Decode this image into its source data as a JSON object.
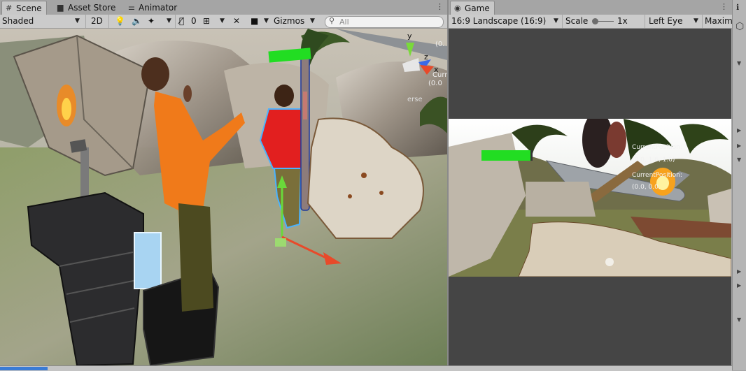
{
  "scene_tabs": [
    {
      "label": "Scene",
      "icon": "grid-icon"
    },
    {
      "label": "Asset Store",
      "icon": "store-icon"
    },
    {
      "label": "Animator",
      "icon": "animator-icon"
    }
  ],
  "scene_toolbar": {
    "draw_mode": "Shaded",
    "mode_2d": "2D",
    "hidden_count": "0",
    "gizmos": "Gizmos",
    "search_placeholder": "All"
  },
  "scene_overlay": {
    "gizmo_y": "y",
    "gizmo_z": "z",
    "gizmo_x": "x",
    "labels": [
      "(0.",
      "Curr",
      "(0.0",
      "erse"
    ]
  },
  "game_tab": {
    "label": "Game",
    "icon": "gamepad-icon"
  },
  "game_toolbar": {
    "aspect": "16:9 Landscape (16:9)",
    "scale_label": "Scale",
    "scale_value": "1x",
    "eye": "Left Eye",
    "maximize": "Maxim"
  },
  "game_overlay": {
    "line1": "CurrentPosition:",
    "line2": "(0.0, 1.6, 1.6)",
    "line3": "CurrentPosition:",
    "line4": "(0.0, 0.0,"
  },
  "colors": {
    "health_bar": "#22dd22",
    "chrome": "#cbcbcb",
    "game_bg": "#454545"
  }
}
